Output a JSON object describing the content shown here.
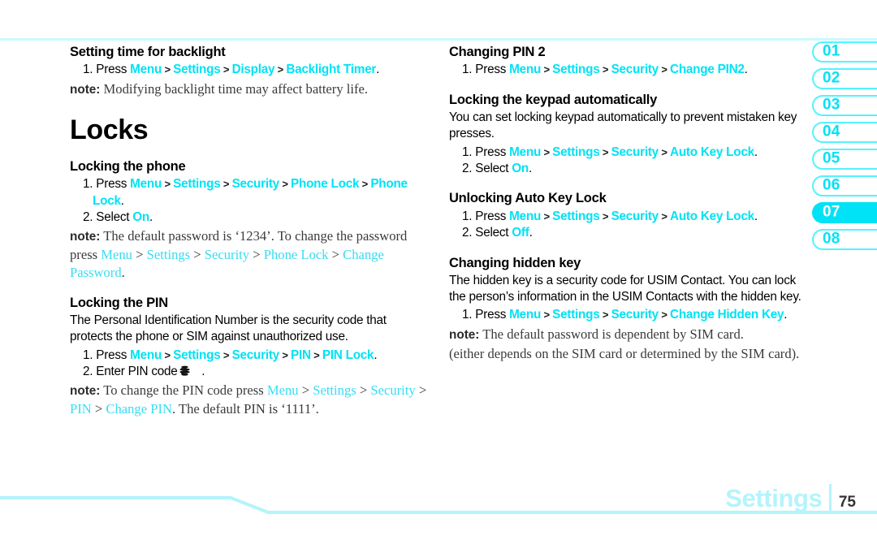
{
  "page": {
    "footer_title": "Settings",
    "page_number": "75",
    "accent_cyan": "#00e2f5",
    "accent_pale": "#b4f4fb",
    "rule_color": "#c9fbff"
  },
  "tabs": {
    "active_index": 6,
    "items": [
      "01",
      "02",
      "03",
      "04",
      "05",
      "06",
      "07",
      "08"
    ]
  },
  "left_column": {
    "sec_backlight": {
      "heading": "Setting time for backlight",
      "step1": {
        "num": "1.",
        "press": "Press",
        "menu": "Menu",
        "settings": "Settings",
        "display": "Display",
        "backlight_timer": "Backlight Timer",
        "period": "."
      },
      "note_label": "note:",
      "note_text": "Modifying backlight time may affect battery life."
    },
    "locks_title": "Locks",
    "sec_phone_lock": {
      "heading": "Locking the phone",
      "step1": {
        "num": "1.",
        "press": "Press",
        "menu": "Menu",
        "settings": "Settings",
        "security": "Security",
        "phone_lock": "Phone Lock",
        "phone_lock2": "Phone Lock",
        "period": "."
      },
      "step2": {
        "num": "2.",
        "select": "Select",
        "value": "On",
        "period": "."
      },
      "note_label": "note:",
      "note_a": "The default password is ‘1234’. To change the password press ",
      "note_menu": "Menu",
      "note_settings": "Settings",
      "note_security": "Security",
      "note_phone_lock": "Phone Lock",
      "note_change_password": "Change Password",
      "note_end": "."
    },
    "sec_pin": {
      "heading": "Locking the PIN",
      "body": "The Personal Identification Number is the security code that protects the phone or SIM against unauthorized use.",
      "step1": {
        "num": "1.",
        "press": "Press",
        "menu": "Menu",
        "settings": "Settings",
        "security": "Security",
        "pin": "PIN",
        "pin_lock": "PIN Lock",
        "period": "."
      },
      "step2": {
        "num": "2.",
        "text": "Enter PIN code >",
        "icon": "att-globe-icon",
        "period": "."
      },
      "note_label": "note:",
      "note_a": "To change the PIN code press ",
      "note_menu": "Menu",
      "note_settings": "Settings",
      "note_security": "Security",
      "note_pin": "PIN",
      "note_change_pin": "Change PIN",
      "note_end": ". The default PIN is ‘1111’."
    }
  },
  "right_column": {
    "sec_pin2": {
      "heading": "Changing PIN 2",
      "step1": {
        "num": "1.",
        "press": "Press",
        "menu": "Menu",
        "settings": "Settings",
        "security": "Security",
        "change_pin2": "Change PIN2",
        "period": "."
      }
    },
    "sec_autokey": {
      "heading": "Locking the keypad automatically",
      "body": "You can set locking keypad automatically to prevent mistaken key presses.",
      "step1": {
        "num": "1.",
        "press": "Press",
        "menu": "Menu",
        "settings": "Settings",
        "security": "Security",
        "auto_key_lock": "Auto Key Lock",
        "period": "."
      },
      "step2": {
        "num": "2.",
        "select": "Select",
        "value": "On",
        "period": "."
      }
    },
    "sec_unlock_autokey": {
      "heading": "Unlocking Auto Key Lock",
      "step1": {
        "num": "1.",
        "press": "Press",
        "menu": "Menu",
        "settings": "Settings",
        "security": "Security",
        "auto_key_lock": "Auto Key Lock",
        "period": "."
      },
      "step2": {
        "num": "2.",
        "select": "Select",
        "value": "Off",
        "period": "."
      }
    },
    "sec_hidden_key": {
      "heading": "Changing hidden key",
      "body": "The hidden key is a security code for USIM Contact. You can lock the person’s information in the USIM Contacts with the hidden key.",
      "step1": {
        "num": "1.",
        "press": "Press",
        "menu": "Menu",
        "settings": "Settings",
        "security": "Security",
        "change_hidden_key": "Change Hidden Key",
        "period": "."
      },
      "note_label": "note:",
      "note_text": "The default password is dependent by SIM card.",
      "note_text2": "(either depends on the SIM card or determined by the SIM card)."
    }
  }
}
